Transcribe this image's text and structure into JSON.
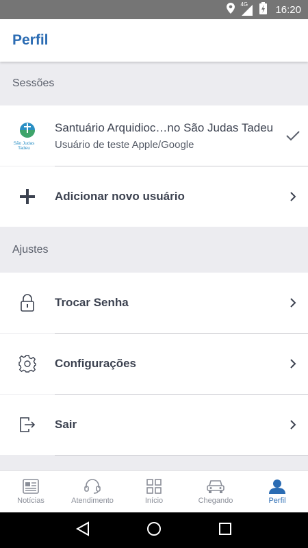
{
  "status_bar": {
    "network": "4G",
    "time": "16:20"
  },
  "app_bar": {
    "title": "Perfil"
  },
  "sections": {
    "sessions": {
      "header": "Sessões"
    },
    "settings": {
      "header": "Ajustes"
    }
  },
  "sessions": {
    "current": {
      "name": "Santuário Arquidioc…no São Judas Tadeu",
      "subtitle": "Usuário de teste Apple/Google",
      "logo_text": "São Judas Tadeu",
      "logo_icon": "church-logo"
    },
    "add_user": {
      "label": "Adicionar novo usuário",
      "icon": "plus-icon"
    }
  },
  "settings": {
    "items": [
      {
        "label": "Trocar Senha",
        "icon": "lock-icon"
      },
      {
        "label": "Configurações",
        "icon": "gear-icon"
      },
      {
        "label": "Sair",
        "icon": "logout-icon"
      }
    ]
  },
  "bottom_nav": {
    "items": [
      {
        "label": "Notícias",
        "icon": "news-icon",
        "active": false
      },
      {
        "label": "Atendimento",
        "icon": "headset-icon",
        "active": false
      },
      {
        "label": "Início",
        "icon": "grid-icon",
        "active": false
      },
      {
        "label": "Chegando",
        "icon": "car-icon",
        "active": false
      },
      {
        "label": "Perfil",
        "icon": "person-icon",
        "active": true
      }
    ]
  },
  "colors": {
    "accent": "#2b6cb3",
    "section_bg": "#ececf0",
    "text": "#3c4250",
    "inactive": "#8a8e98"
  }
}
